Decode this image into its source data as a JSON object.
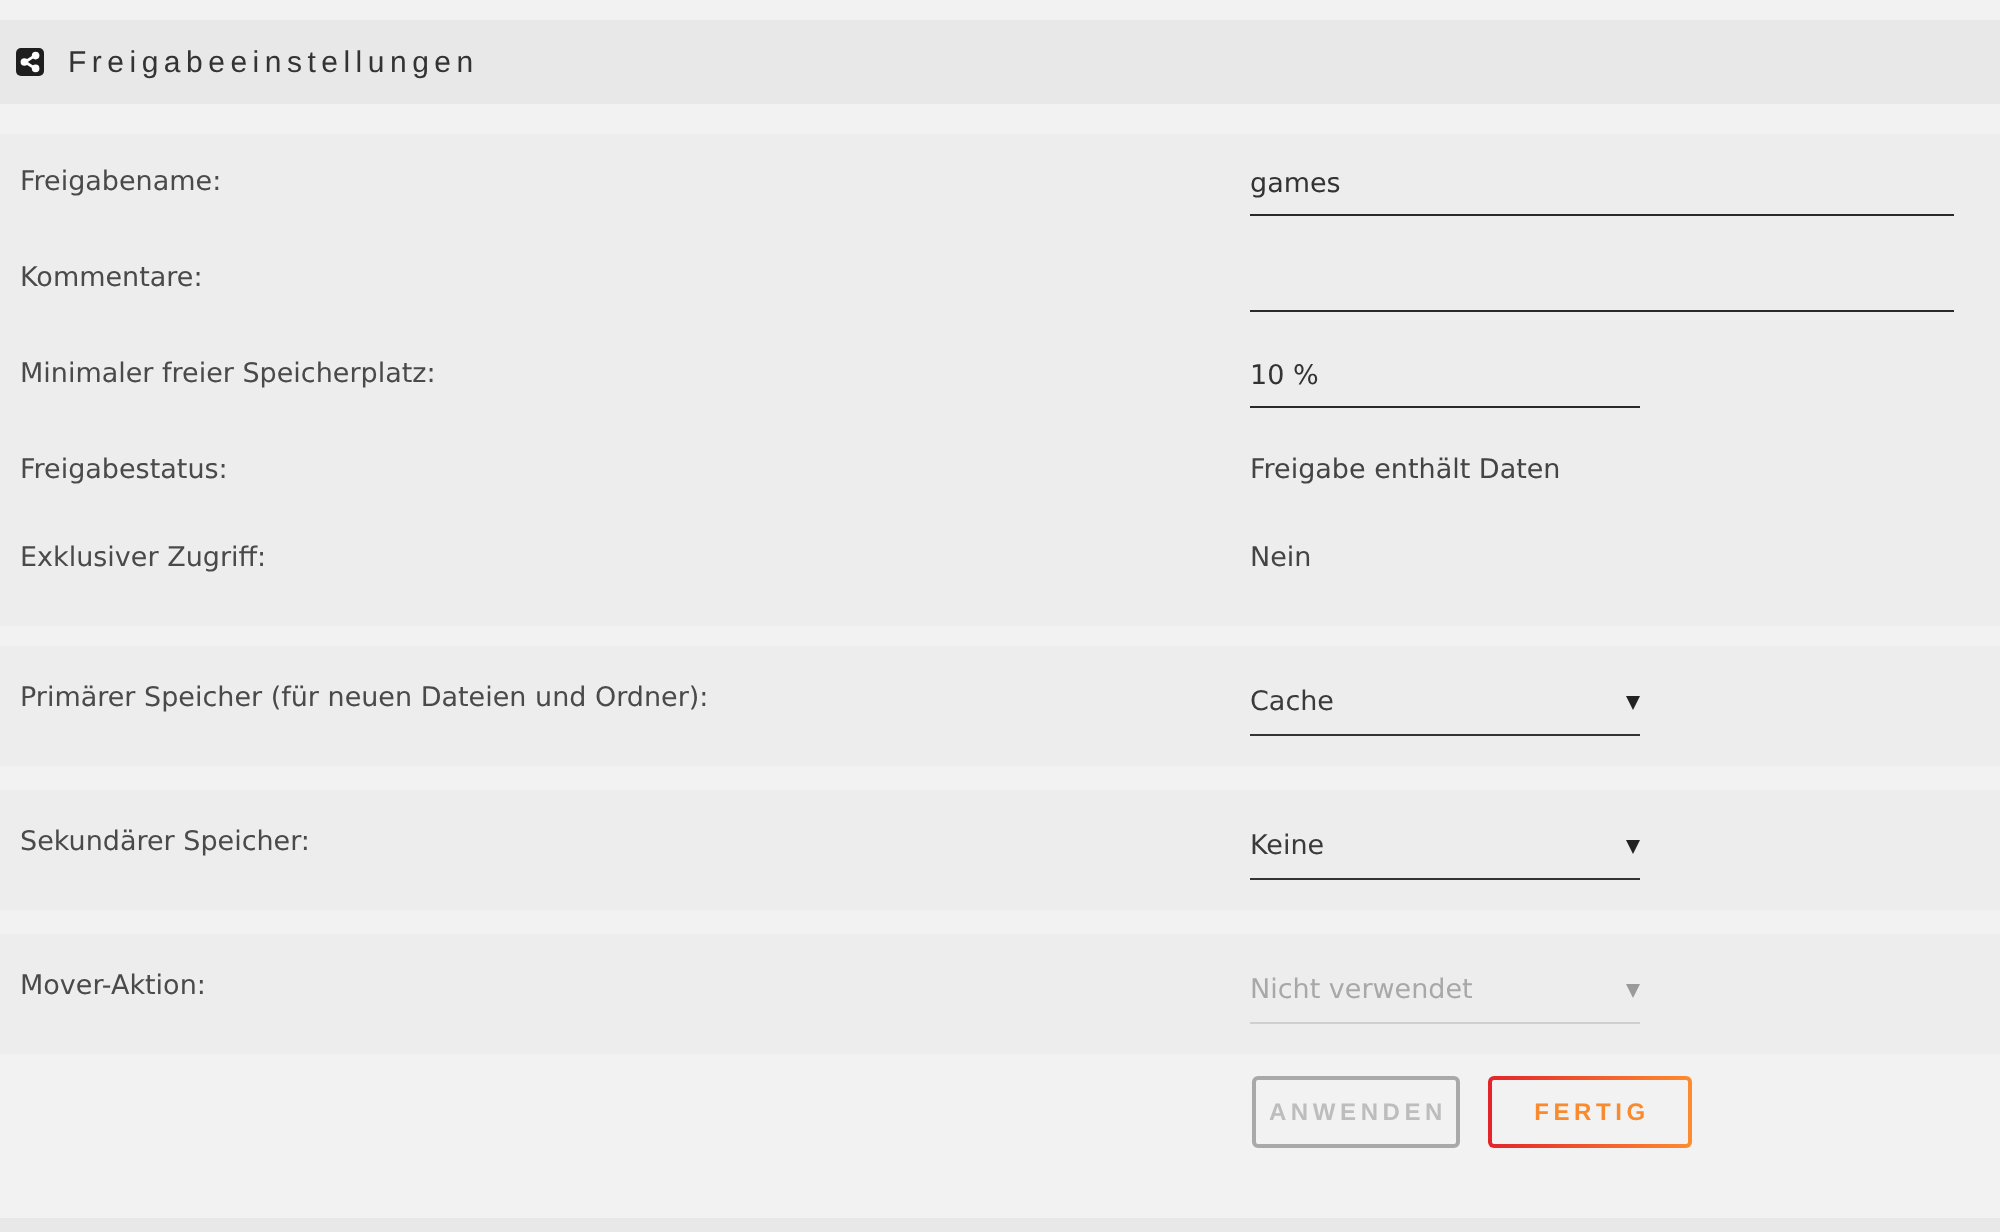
{
  "panel": {
    "title": "Freigabeeinstellungen"
  },
  "sections": [
    {
      "rows": [
        {
          "kind": "text_field",
          "label": "Freigabename:",
          "value": "games"
        },
        {
          "kind": "text_field",
          "label": "Kommentare:"
        },
        {
          "kind": "short_field",
          "label": "Minimaler freier Speicherplatz:",
          "value": "10 %"
        },
        {
          "kind": "static",
          "label": "Freigabestatus:",
          "value": "Freigabe enthält Daten"
        },
        {
          "kind": "static",
          "label": "Exklusiver Zugriff:",
          "value": "Nein"
        }
      ]
    },
    {
      "rows": [
        {
          "kind": "dropdown",
          "label": "Primärer Speicher (für neuen Dateien und Ordner):",
          "value": "Cache",
          "disabled": false
        }
      ]
    },
    {
      "rows": [
        {
          "kind": "dropdown",
          "label": "Sekundärer Speicher:",
          "value": "Keine",
          "disabled": false
        }
      ]
    },
    {
      "rows": [
        {
          "kind": "dropdown",
          "label": "Mover-Aktion:",
          "value": "Nicht verwendet",
          "disabled": true
        }
      ]
    }
  ],
  "buttons": [
    {
      "label": "ANWENDEN",
      "disabled": true
    },
    {
      "label": "FERTIG",
      "disabled": false
    }
  ]
}
